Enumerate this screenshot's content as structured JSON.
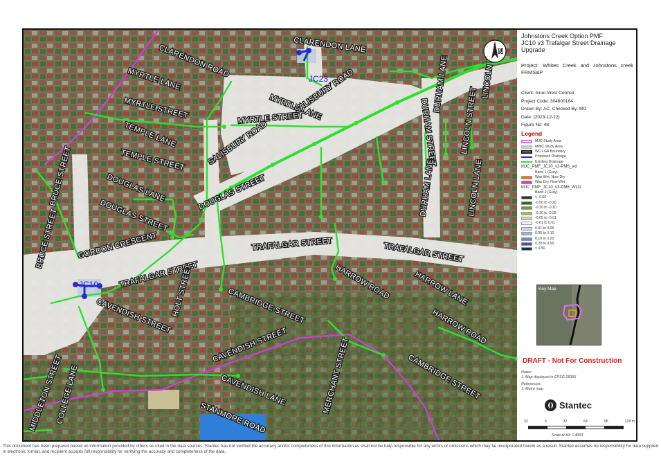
{
  "title_block": {
    "title": "Johnstons Creek Option PMF\nJC10 v3 Trafalgar Street Drainage\nUpgrade",
    "project": "Project:  Whites Creek and Johnstons creek FRMS&P",
    "client": "Client:  Inner West Council",
    "project_code": "Project Code:  304600164",
    "drawn_by": "Drawn By:  AC, Checked By: MG",
    "date": "Date:  (2023-12-22)",
    "figure_no": "Figure No:  48"
  },
  "legend": {
    "heading": "Legend",
    "items": [
      {
        "label": "MJC Study Area",
        "color": "#e070e8",
        "kind": "box"
      },
      {
        "label": "MWC Study Area",
        "color": "#ffffff",
        "kind": "box"
      },
      {
        "label": "WC LGA Boundary",
        "color": "#111111",
        "kind": "box"
      },
      {
        "label": "Proposed Drainage",
        "color": "#2a2ad0",
        "kind": "line"
      },
      {
        "label": "Existing Drainage",
        "color": "#2ee02e",
        "kind": "line"
      },
      {
        "label": "MJC_PMF_JC10_v3-PM6_wd",
        "color": "",
        "kind": "text"
      },
      {
        "label": "Band 1 (Gray)",
        "color": "",
        "kind": "text"
      },
      {
        "label": "Was Wet, Now Dry",
        "color": "#e07a1a",
        "kind": "fill"
      },
      {
        "label": "Was Dry, Now Wet",
        "color": "#e030c8",
        "kind": "fill"
      },
      {
        "label": "MJC_PMF_JC10_v3-PM6_WLD",
        "color": "",
        "kind": "text"
      },
      {
        "label": "Band 1 (Gray)",
        "color": "",
        "kind": "text"
      },
      {
        "label": "< -0.50",
        "color": "#1f3d12",
        "kind": "fill"
      },
      {
        "label": "-0.50 to -0.20",
        "color": "#3c6a1e",
        "kind": "fill"
      },
      {
        "label": "-0.20 to -0.10",
        "color": "#6a9a3a",
        "kind": "fill"
      },
      {
        "label": "-0.10 to -0.05",
        "color": "#9cc06a",
        "kind": "fill"
      },
      {
        "label": "-0.05 to -0.01",
        "color": "#c8dca8",
        "kind": "fill"
      },
      {
        "label": "-0.01 to 0.01",
        "color": "#f2f2f2",
        "kind": "fill"
      },
      {
        "label": "0.01 to 0.05",
        "color": "#c9d3e6",
        "kind": "fill"
      },
      {
        "label": "0.05 to 0.10",
        "color": "#9fb0d4",
        "kind": "fill"
      },
      {
        "label": "0.10 to 0.20",
        "color": "#7088bd",
        "kind": "fill"
      },
      {
        "label": "0.20 to 0.50",
        "color": "#3e5a98",
        "kind": "fill"
      },
      {
        "label": "> 0.50",
        "color": "#1b2b62",
        "kind": "fill"
      }
    ]
  },
  "key_map": {
    "label": "Key Map"
  },
  "draft_notice": "DRAFT - Not For Construction",
  "notes": {
    "heading": "Notes:",
    "text": "1. Map displayed in EPSG:28356",
    "ref_heading": "References:",
    "ref_text": "1. Metro map"
  },
  "logo": {
    "name": "Stantec"
  },
  "scale": {
    "ticks": [
      "32",
      "0",
      "32",
      "64",
      "96",
      "128 m"
    ],
    "ratio": "Scale at A3: 1:4000"
  },
  "north_arrow": {
    "label": "N"
  },
  "map": {
    "roads": [
      "CLARENDON ROAD",
      "CLARENDON LANE",
      "MYRTLE LANE",
      "MYRTLE STREET",
      "MYRTLE LANE",
      "MYRTLE STREET",
      "SALISBURY ROAD",
      "SALISBURY ROAD",
      "TEMPLE LANE",
      "TEMPLE STREET",
      "DOUGLAS LANE",
      "DOUGLAS STREET",
      "DOUGLAS STREET",
      "BRUCE STREET",
      "BRUCE STREET",
      "GORDON CRESCENT",
      "TRAFALGAR STREET",
      "TRAFALGAR STREET",
      "TRAFALGAR STREET",
      "DURHAM STREET",
      "DURHAM LANE",
      "DURHAM LANE",
      "LINCOLN STREET",
      "LINCOLN LANE",
      "LINCOLN LANE",
      "HARROW ROAD",
      "HARROW LANE",
      "HARROW ROAD",
      "CAVENDISH STREET",
      "CAMBRIDGE STREET",
      "HOLT STREET",
      "CAVENDISH STREET",
      "CAVENDISH LANE",
      "STANMORE ROAD",
      "MERCHANT STREET",
      "CAMBRIDGE STREET",
      "MIDDLETON STREET",
      "COLLEGE LANE"
    ],
    "labels": [
      "JC23",
      "JC10"
    ]
  },
  "disclaimer": "This document has been prepared based on information provided by others as cited in the data sources. Stantec has not verified the accuracy and/or completeness of this information as shall not be help responsible for any errors or omissions which may be incorporated herein as a result. Stantec assumes no responsibility for data supplied in electronic format, and recipient accepts full responsibility for verifying the accuracy and completeness of the data."
}
